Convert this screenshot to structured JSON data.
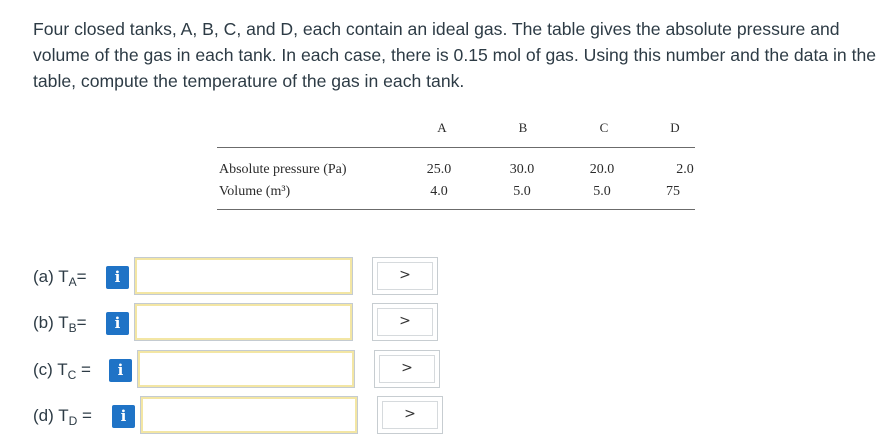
{
  "question": {
    "text": "Four closed tanks, A, B, C, and D, each contain an ideal gas. The table gives the absolute pressure and volume of the gas in each tank. In each case, there is 0.15 mol of gas. Using this number and the data in the table, compute the temperature of the gas in each tank."
  },
  "table": {
    "columns": [
      "A",
      "B",
      "C",
      "D"
    ],
    "rows": [
      {
        "label": "Absolute pressure (Pa)",
        "values": [
          "25.0",
          "30.0",
          "20.0",
          "2.0"
        ]
      },
      {
        "label": "Volume (m³)",
        "values": [
          "4.0",
          "5.0",
          "5.0",
          "75"
        ]
      }
    ]
  },
  "answers": [
    {
      "prefix": "(a) T",
      "sub": "A",
      "suffix": "=",
      "info": "i",
      "value": "",
      "unit_chevron": ">"
    },
    {
      "prefix": "(b) T",
      "sub": "B",
      "suffix": "=",
      "info": "i",
      "value": "",
      "unit_chevron": ">"
    },
    {
      "prefix": "(c) T",
      "sub": "C",
      "suffix": " =",
      "info": "i",
      "value": "",
      "unit_chevron": ">"
    },
    {
      "prefix": "(d) T",
      "sub": "D",
      "suffix": " =",
      "info": "i",
      "value": "",
      "unit_chevron": ">"
    }
  ],
  "colors": {
    "info_button": "#1f73c6",
    "input_border": "#c4cbd1",
    "text": "#2d3b45"
  }
}
